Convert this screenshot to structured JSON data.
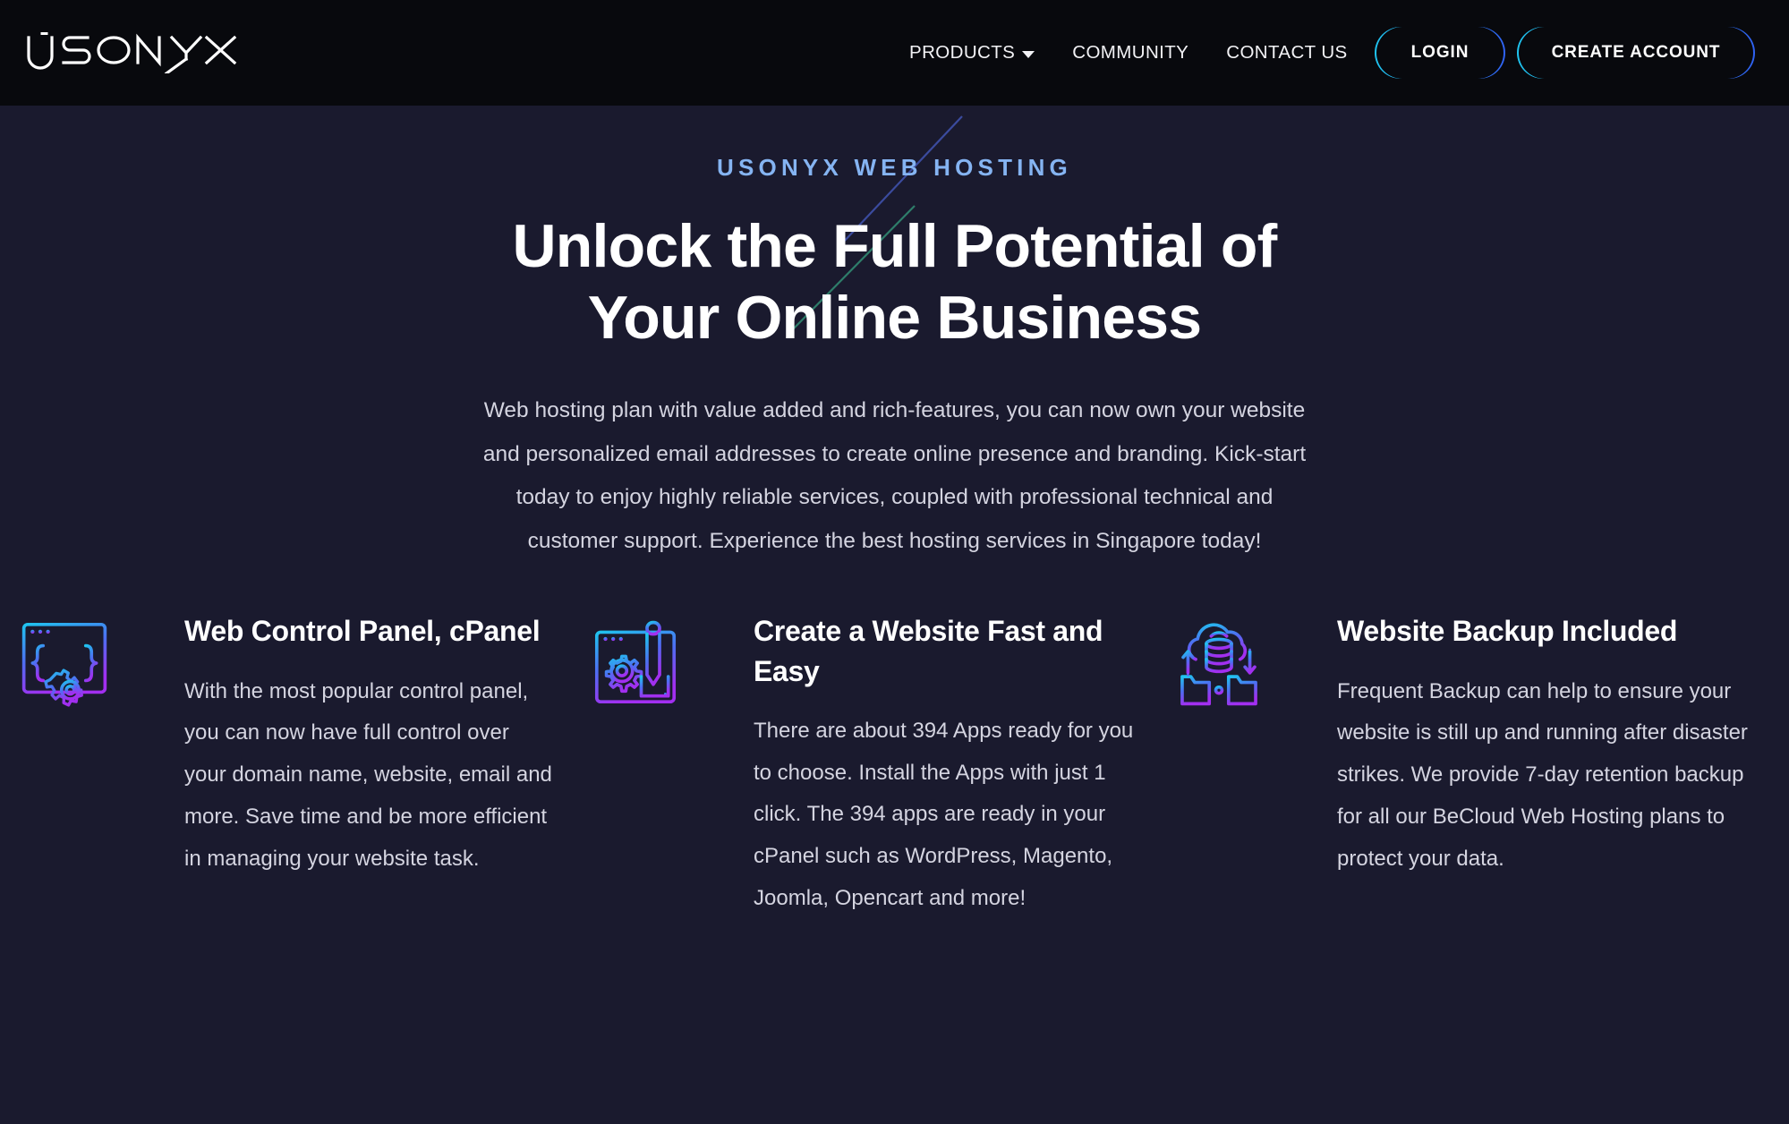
{
  "brand": {
    "logo_text": "USONYX",
    "logo_name": "usonyx-logo"
  },
  "colors": {
    "header_bg": "#08090d",
    "page_bg": "#1a1a2e",
    "accent_cyan": "#1fc4ef",
    "accent_blue": "#2f62f3",
    "eyebrow_blue": "#85b4f2",
    "body_text": "#d4d4e0",
    "icon_gradient_start": "#1fc4ef",
    "icon_gradient_end": "#a22ff0",
    "deco_line_blue": "#3b4b9e",
    "deco_line_teal": "#2e7d6a"
  },
  "nav": {
    "items": [
      {
        "label": "PRODUCTS",
        "icon": "chevron-down-icon",
        "has_dropdown": true
      },
      {
        "label": "COMMUNITY",
        "has_dropdown": false
      },
      {
        "label": "CONTACT US",
        "has_dropdown": false
      }
    ]
  },
  "auth": {
    "login_label": "LOGIN",
    "create_account_label": "CREATE ACCOUNT"
  },
  "hero": {
    "eyebrow": "USONYX WEB HOSTING",
    "headline_line1": "Unlock the Full Potential of",
    "headline_line2": "Your Online Business",
    "paragraph": "Web hosting plan with value added and rich-features, you can now own your website and personalized email addresses to create online presence and branding. Kick-start today to enjoy highly reliable services, coupled with professional technical and customer support. Experience the best hosting services in Singapore today!"
  },
  "features": [
    {
      "icon": "browser-code-gear-icon",
      "title": "Web Control Panel, cPanel",
      "text": "With the most popular control panel, you can now have full control over your domain name, website, email and more. Save time and be more efficient in managing your website task."
    },
    {
      "icon": "browser-pencil-gear-icon",
      "title": "Create a Website Fast and Easy",
      "text": "There are about 394 Apps ready for you to choose. Install the Apps with just 1 click. The 394 apps are ready in your cPanel such as WordPress, Magento, Joomla, Opencart and more!"
    },
    {
      "icon": "cloud-backup-folders-icon",
      "title": "Website Backup Included",
      "text": "Frequent Backup can help to ensure your website is still up and running after disaster strikes. We provide 7-day retention backup for all our BeCloud Web Hosting plans to protect your data."
    }
  ]
}
